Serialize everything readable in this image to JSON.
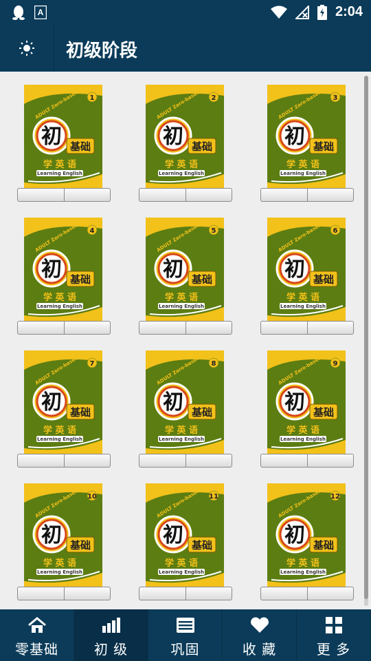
{
  "status_bar": {
    "time": "2:04"
  },
  "app_bar": {
    "title": "初级阶段"
  },
  "books": [
    {
      "number": "1",
      "char": "初",
      "sub": "基础",
      "line": "学 英 语",
      "eng": "Learning English",
      "top": "ADULT Zero-based"
    },
    {
      "number": "2",
      "char": "初",
      "sub": "基础",
      "line": "学 英 语",
      "eng": "Learning English",
      "top": "ADULT Zero-based"
    },
    {
      "number": "3",
      "char": "初",
      "sub": "基础",
      "line": "学 英 语",
      "eng": "Learning English",
      "top": "ADULT Zero-based"
    },
    {
      "number": "4",
      "char": "初",
      "sub": "基础",
      "line": "学 英 语",
      "eng": "Learning English",
      "top": "ADULT Zero-based"
    },
    {
      "number": "5",
      "char": "初",
      "sub": "基础",
      "line": "学 英 语",
      "eng": "Learning English",
      "top": "ADULT Zero-based"
    },
    {
      "number": "6",
      "char": "初",
      "sub": "基础",
      "line": "学 英 语",
      "eng": "Learning English",
      "top": "ADULT Zero-based"
    },
    {
      "number": "7",
      "char": "初",
      "sub": "基础",
      "line": "学 英 语",
      "eng": "Learning English",
      "top": "ADULT Zero-based"
    },
    {
      "number": "8",
      "char": "初",
      "sub": "基础",
      "line": "学 英 语",
      "eng": "Learning English",
      "top": "ADULT Zero-based"
    },
    {
      "number": "9",
      "char": "初",
      "sub": "基础",
      "line": "学 英 语",
      "eng": "Learning English",
      "top": "ADULT Zero-based"
    },
    {
      "number": "10",
      "char": "初",
      "sub": "基础",
      "line": "学 英 语",
      "eng": "Learning English",
      "top": "ADULT Zero-based"
    },
    {
      "number": "11",
      "char": "初",
      "sub": "基础",
      "line": "学 英 语",
      "eng": "Learning English",
      "top": "ADULT Zero-based"
    },
    {
      "number": "12",
      "char": "初",
      "sub": "基础",
      "line": "学 英 语",
      "eng": "Learning English",
      "top": "ADULT Zero-based"
    }
  ],
  "bottom_nav": [
    {
      "label": "零基础",
      "icon": "home-icon",
      "active": false
    },
    {
      "label": "初 级",
      "icon": "bar-chart-icon",
      "active": true
    },
    {
      "label": "巩固",
      "icon": "list-icon",
      "active": false
    },
    {
      "label": "收 藏",
      "icon": "heart-icon",
      "active": false
    },
    {
      "label": "更 多",
      "icon": "grid-icon",
      "active": false
    }
  ],
  "colors": {
    "bar": "#0b3b59",
    "cover_green": "#5c7d12",
    "cover_yellow": "#f2c11a"
  }
}
